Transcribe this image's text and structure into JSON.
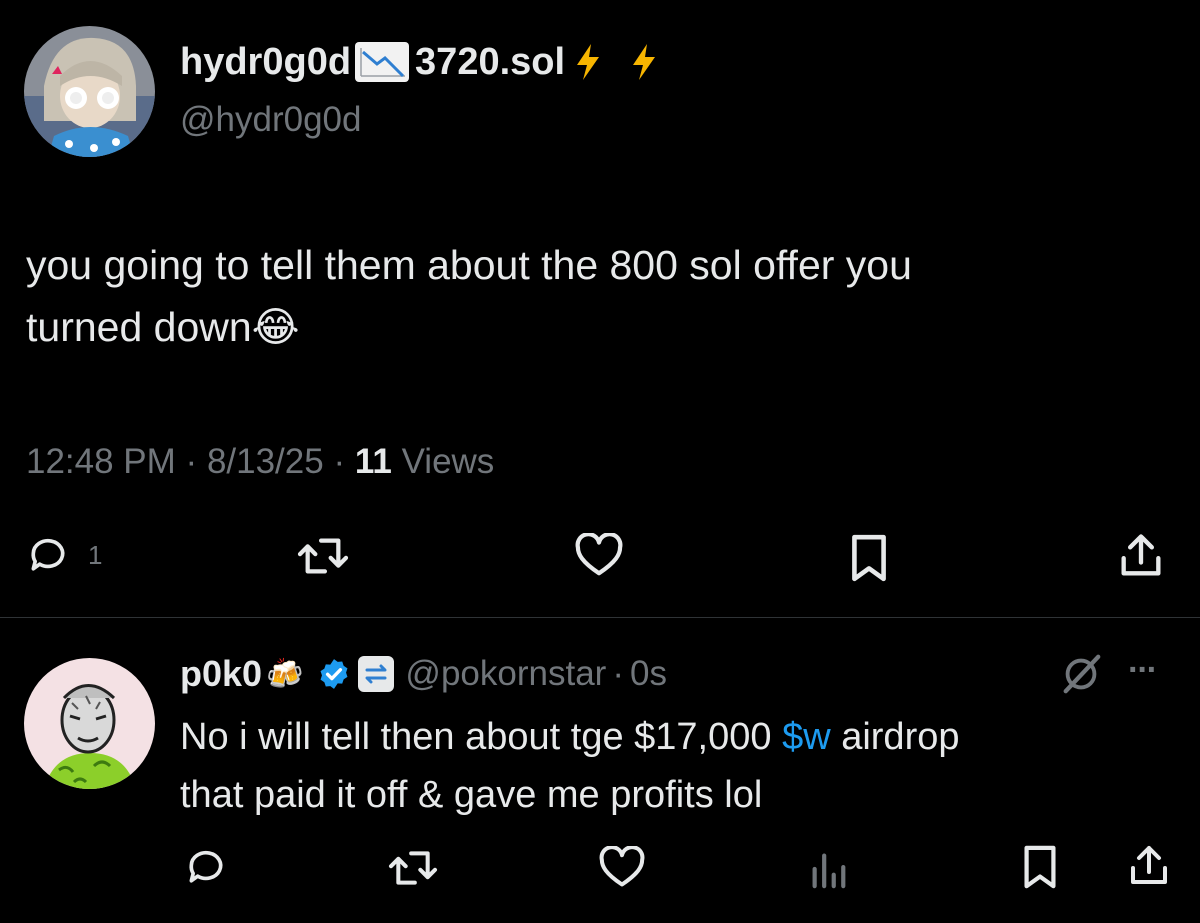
{
  "colors": {
    "background": "#000000",
    "text": "#e7e9ea",
    "muted": "#71767b",
    "link": "#1d9bf0",
    "verified": "#1d9bf0",
    "divider": "#2f3336"
  },
  "main_tweet": {
    "display_name_part1": "hydr0g0d",
    "display_name_part2": "3720.sol",
    "name_icons": [
      "chart-decreasing-icon",
      "lightning-icon",
      "lightning-icon"
    ],
    "handle": "@hydr0g0d",
    "text_line1": "you going to tell them about the 800 sol offer you",
    "text_line2": "turned down",
    "text_emoji": "😂",
    "time": "12:48 PM",
    "sep1": "·",
    "date": "8/13/25",
    "sep2": "·",
    "views_count": "11",
    "views_label": "Views",
    "actions": {
      "reply_count": "1",
      "icons": [
        "reply-icon",
        "retweet-icon",
        "like-icon",
        "bookmark-icon",
        "share-icon"
      ]
    }
  },
  "reply_tweet": {
    "display_name": "p0k0",
    "name_emoji": "🍻",
    "badges": [
      "verified-badge-icon",
      "affiliate-badge-icon"
    ],
    "handle": "@pokornstar",
    "sep": "·",
    "time": "0s",
    "text_line1_before": "No i will tell then about tge $17,000 ",
    "cashtag": "$w",
    "text_line1_after": " airdrop",
    "text_line2": "that paid it off & gave me profits lol",
    "more": "···",
    "actions": {
      "icons": [
        "reply-icon",
        "retweet-icon",
        "like-icon",
        "views-icon",
        "bookmark-icon",
        "share-icon"
      ]
    }
  }
}
